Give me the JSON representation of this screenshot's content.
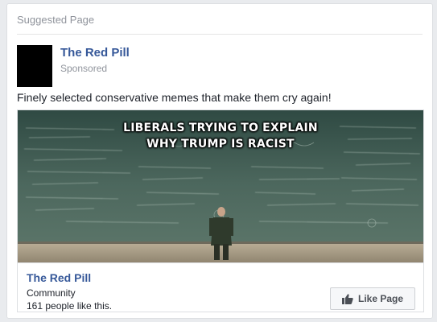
{
  "header": {
    "suggested_label": "Suggested Page"
  },
  "post": {
    "page_name": "The Red Pill",
    "sponsored_label": "Sponsored",
    "text": "Finely selected conservative memes that make them cry again!",
    "image_caption_line1": "LIBERALS TRYING TO EXPLAIN",
    "image_caption_line2": "WHY TRUMP IS RACIST"
  },
  "footer": {
    "page_name": "The Red Pill",
    "category": "Community",
    "likes_text": "161 people like this.",
    "like_button_label": "Like Page"
  },
  "colors": {
    "link_blue": "#365899",
    "muted_gray": "#90949c",
    "chalkboard": "#4f6b60"
  },
  "icons": {
    "like_button_icon": "thumbs-up-icon"
  }
}
